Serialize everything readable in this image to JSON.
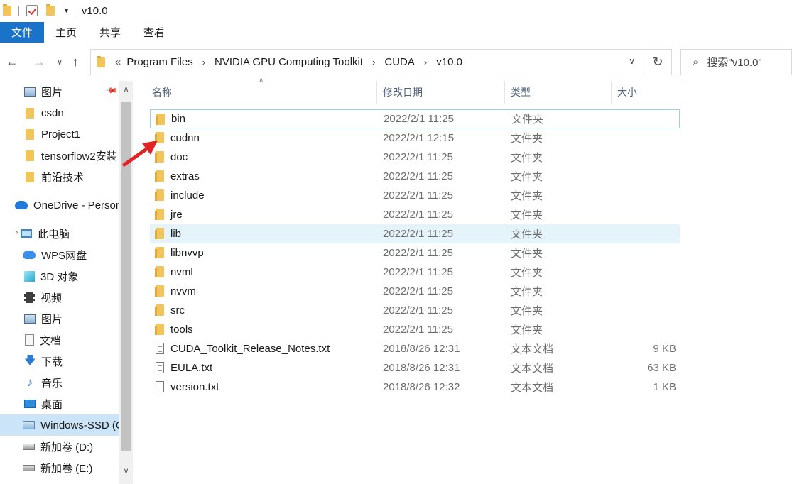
{
  "window": {
    "title": "v10.0"
  },
  "ribbon": {
    "tabs": [
      "文件",
      "主页",
      "共享",
      "查看"
    ]
  },
  "address": {
    "overflow": "«",
    "crumbs": [
      "Program Files",
      "NVIDIA GPU Computing Toolkit",
      "CUDA",
      "v10.0"
    ],
    "search_placeholder": "搜索\"v10.0\""
  },
  "nav": {
    "items": [
      {
        "label": "图片",
        "icon": "pictures-icon"
      },
      {
        "label": "csdn",
        "icon": "folder-icon"
      },
      {
        "label": "Project1",
        "icon": "folder-icon"
      },
      {
        "label": "tensorflow2安装",
        "icon": "folder-icon"
      },
      {
        "label": "前沿技术",
        "icon": "folder-icon"
      },
      {
        "label": "OneDrive - Personal",
        "icon": "onedrive-icon"
      },
      {
        "label": "此电脑",
        "icon": "this-pc-icon"
      },
      {
        "label": "WPS网盘",
        "icon": "wps-cloud-icon"
      },
      {
        "label": "3D 对象",
        "icon": "3d-objects-icon"
      },
      {
        "label": "视频",
        "icon": "videos-icon"
      },
      {
        "label": "图片",
        "icon": "pictures-icon"
      },
      {
        "label": "文档",
        "icon": "documents-icon"
      },
      {
        "label": "下载",
        "icon": "downloads-icon"
      },
      {
        "label": "音乐",
        "icon": "music-icon"
      },
      {
        "label": "桌面",
        "icon": "desktop-icon"
      },
      {
        "label": "Windows-SSD (C:)",
        "icon": "ssd-drive-icon"
      },
      {
        "label": "新加卷 (D:)",
        "icon": "drive-icon"
      },
      {
        "label": "新加卷 (E:)",
        "icon": "drive-icon"
      }
    ]
  },
  "columns": {
    "name": "名称",
    "date": "修改日期",
    "type": "类型",
    "size": "大小"
  },
  "files": [
    {
      "name": "bin",
      "date": "2022/2/1 11:25",
      "type": "文件夹",
      "size": "",
      "kind": "folder"
    },
    {
      "name": "cudnn",
      "date": "2022/2/1 12:15",
      "type": "文件夹",
      "size": "",
      "kind": "folder"
    },
    {
      "name": "doc",
      "date": "2022/2/1 11:25",
      "type": "文件夹",
      "size": "",
      "kind": "folder"
    },
    {
      "name": "extras",
      "date": "2022/2/1 11:25",
      "type": "文件夹",
      "size": "",
      "kind": "folder"
    },
    {
      "name": "include",
      "date": "2022/2/1 11:25",
      "type": "文件夹",
      "size": "",
      "kind": "folder"
    },
    {
      "name": "jre",
      "date": "2022/2/1 11:25",
      "type": "文件夹",
      "size": "",
      "kind": "folder"
    },
    {
      "name": "lib",
      "date": "2022/2/1 11:25",
      "type": "文件夹",
      "size": "",
      "kind": "folder"
    },
    {
      "name": "libnvvp",
      "date": "2022/2/1 11:25",
      "type": "文件夹",
      "size": "",
      "kind": "folder"
    },
    {
      "name": "nvml",
      "date": "2022/2/1 11:25",
      "type": "文件夹",
      "size": "",
      "kind": "folder"
    },
    {
      "name": "nvvm",
      "date": "2022/2/1 11:25",
      "type": "文件夹",
      "size": "",
      "kind": "folder"
    },
    {
      "name": "src",
      "date": "2022/2/1 11:25",
      "type": "文件夹",
      "size": "",
      "kind": "folder"
    },
    {
      "name": "tools",
      "date": "2022/2/1 11:25",
      "type": "文件夹",
      "size": "",
      "kind": "folder"
    },
    {
      "name": "CUDA_Toolkit_Release_Notes.txt",
      "date": "2018/8/26 12:31",
      "type": "文本文档",
      "size": "9 KB",
      "kind": "txt"
    },
    {
      "name": "EULA.txt",
      "date": "2018/8/26 12:31",
      "type": "文本文档",
      "size": "63 KB",
      "kind": "txt"
    },
    {
      "name": "version.txt",
      "date": "2018/8/26 12:32",
      "type": "文本文档",
      "size": "1 KB",
      "kind": "txt"
    }
  ],
  "colors": {
    "accent": "#1a73c8",
    "selected": "#cce4f7",
    "hover": "#e5f3fb",
    "arrow": "#e02424"
  }
}
